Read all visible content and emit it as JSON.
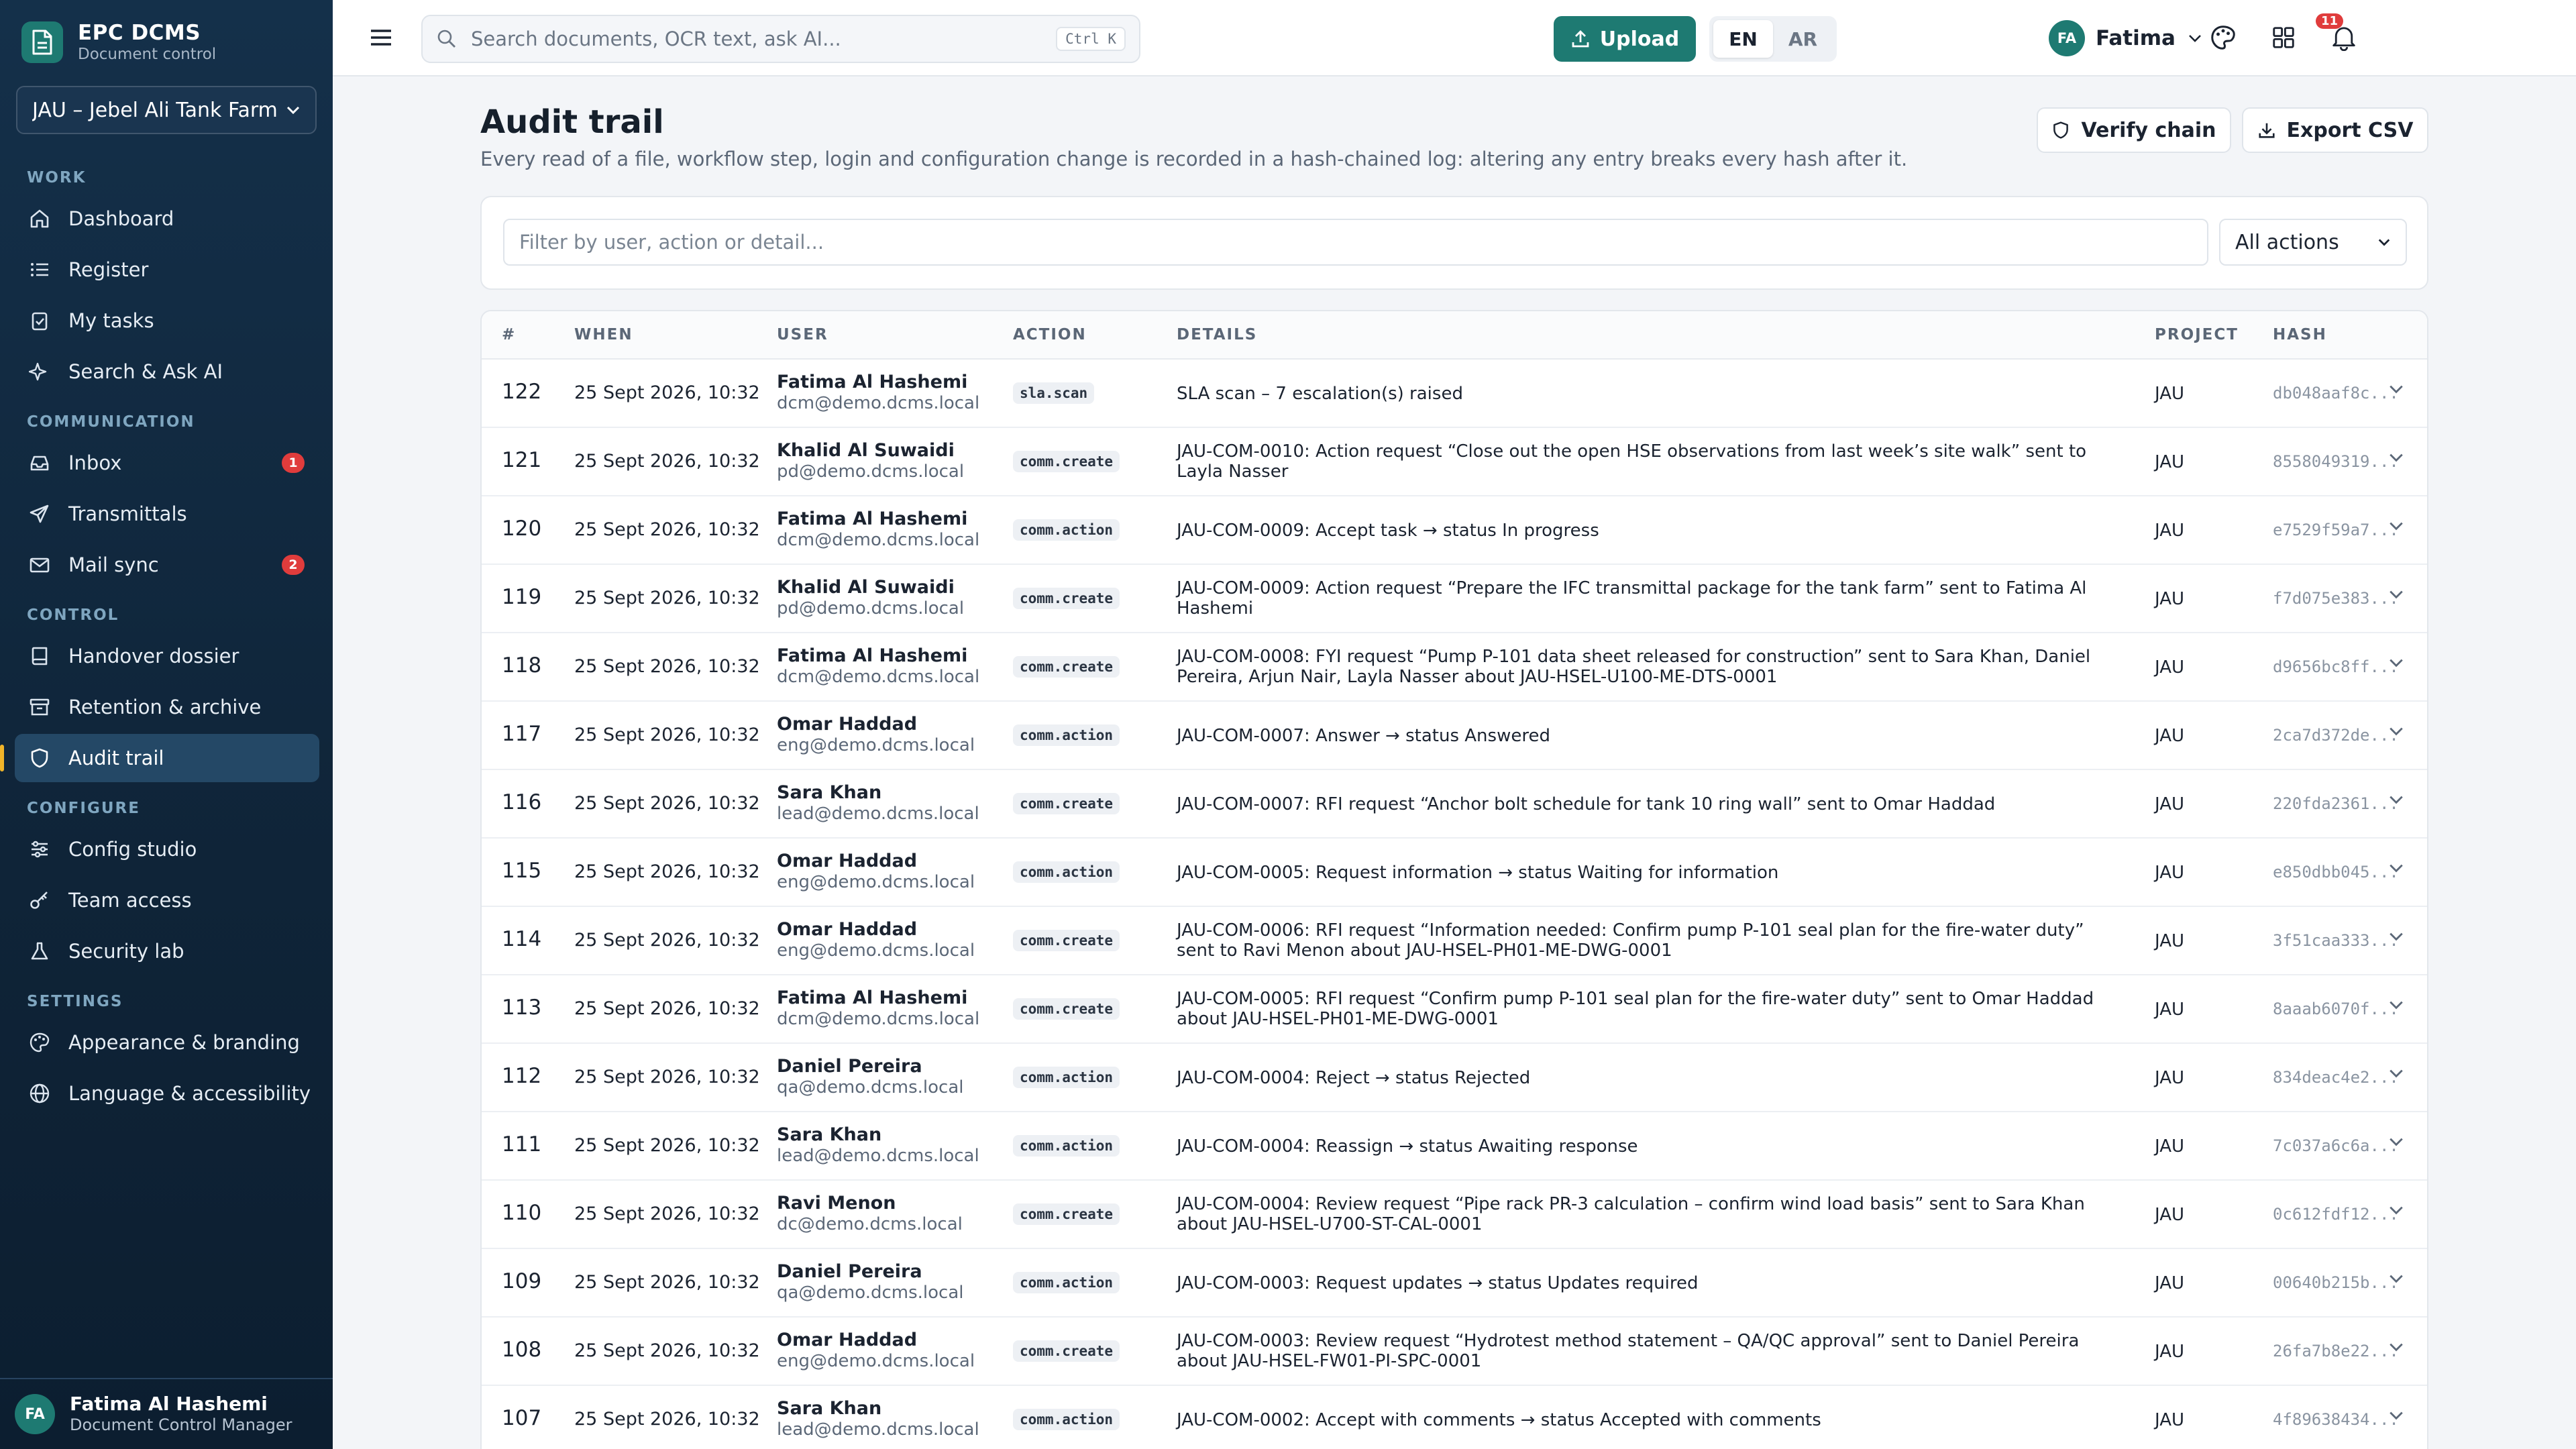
{
  "app": {
    "title": "EPC DCMS",
    "subtitle": "Document control"
  },
  "project_select": {
    "value": "JAU – Jebel Ali Tank Farm E"
  },
  "sidebar": {
    "sections": {
      "work": "WORK",
      "communication": "COMMUNICATION",
      "control": "CONTROL",
      "configure": "CONFIGURE",
      "settings": "SETTINGS"
    },
    "items": [
      {
        "label": "Dashboard",
        "icon": "home-icon"
      },
      {
        "label": "Register",
        "icon": "list-icon"
      },
      {
        "label": "My tasks",
        "icon": "clipboard-icon"
      },
      {
        "label": "Search & Ask AI",
        "icon": "sparkle-icon"
      },
      {
        "label": "Inbox",
        "icon": "inbox-icon",
        "badge": "1"
      },
      {
        "label": "Transmittals",
        "icon": "send-icon"
      },
      {
        "label": "Mail sync",
        "icon": "mail-icon",
        "badge": "2"
      },
      {
        "label": "Handover dossier",
        "icon": "book-icon"
      },
      {
        "label": "Retention & archive",
        "icon": "archive-icon"
      },
      {
        "label": "Audit trail",
        "icon": "shield-icon",
        "active": true
      },
      {
        "label": "Config studio",
        "icon": "sliders-icon"
      },
      {
        "label": "Team access",
        "icon": "key-icon"
      },
      {
        "label": "Security lab",
        "icon": "flask-icon"
      },
      {
        "label": "Appearance & branding",
        "icon": "palette-icon"
      },
      {
        "label": "Language & accessibility",
        "icon": "globe-icon"
      }
    ],
    "user": {
      "initials": "FA",
      "name": "Fatima Al Hashemi",
      "role": "Document Control Manager"
    }
  },
  "topbar": {
    "search_placeholder": "Search documents, OCR text, ask AI...",
    "search_shortcut": "Ctrl K",
    "upload_label": "Upload",
    "lang": {
      "en": "EN",
      "ar": "AR",
      "active": "EN"
    },
    "notifications_count": "11",
    "user": {
      "initials": "FA",
      "name": "Fatima"
    }
  },
  "page": {
    "title": "Audit trail",
    "description": "Every read of a file, workflow step, login and configuration change is recorded in a hash-chained log: altering any entry breaks every hash after it.",
    "verify_label": "Verify chain",
    "export_label": "Export CSV"
  },
  "filter": {
    "placeholder": "Filter by user, action or detail...",
    "action_select": "All actions"
  },
  "table": {
    "headers": {
      "num": "#",
      "when": "WHEN",
      "user": "USER",
      "action": "ACTION",
      "details": "DETAILS",
      "project": "PROJECT",
      "hash": "HASH"
    },
    "rows": [
      {
        "num": "122",
        "when": "25 Sept 2026, 10:32",
        "user": "Fatima Al Hashemi",
        "email": "dcm@demo.dcms.local",
        "action": "sla.scan",
        "details": "SLA scan – 7 escalation(s) raised",
        "project": "JAU",
        "hash": "db048aaf8c..."
      },
      {
        "num": "121",
        "when": "25 Sept 2026, 10:32",
        "user": "Khalid Al Suwaidi",
        "email": "pd@demo.dcms.local",
        "action": "comm.create",
        "details": "JAU-COM-0010: Action request “Close out the open HSE observations from last week’s site walk” sent to Layla Nasser",
        "project": "JAU",
        "hash": "8558049319..."
      },
      {
        "num": "120",
        "when": "25 Sept 2026, 10:32",
        "user": "Fatima Al Hashemi",
        "email": "dcm@demo.dcms.local",
        "action": "comm.action",
        "details": "JAU-COM-0009: Accept task → status In progress",
        "project": "JAU",
        "hash": "e7529f59a7..."
      },
      {
        "num": "119",
        "when": "25 Sept 2026, 10:32",
        "user": "Khalid Al Suwaidi",
        "email": "pd@demo.dcms.local",
        "action": "comm.create",
        "details": "JAU-COM-0009: Action request “Prepare the IFC transmittal package for the tank farm” sent to Fatima Al Hashemi",
        "project": "JAU",
        "hash": "f7d075e383..."
      },
      {
        "num": "118",
        "when": "25 Sept 2026, 10:32",
        "user": "Fatima Al Hashemi",
        "email": "dcm@demo.dcms.local",
        "action": "comm.create",
        "details": "JAU-COM-0008: FYI request “Pump P-101 data sheet released for construction” sent to Sara Khan, Daniel Pereira, Arjun Nair, Layla Nasser about JAU-HSEL-U100-ME-DTS-0001",
        "project": "JAU",
        "hash": "d9656bc8ff..."
      },
      {
        "num": "117",
        "when": "25 Sept 2026, 10:32",
        "user": "Omar Haddad",
        "email": "eng@demo.dcms.local",
        "action": "comm.action",
        "details": "JAU-COM-0007: Answer → status Answered",
        "project": "JAU",
        "hash": "2ca7d372de..."
      },
      {
        "num": "116",
        "when": "25 Sept 2026, 10:32",
        "user": "Sara Khan",
        "email": "lead@demo.dcms.local",
        "action": "comm.create",
        "details": "JAU-COM-0007: RFI request “Anchor bolt schedule for tank 10 ring wall” sent to Omar Haddad",
        "project": "JAU",
        "hash": "220fda2361..."
      },
      {
        "num": "115",
        "when": "25 Sept 2026, 10:32",
        "user": "Omar Haddad",
        "email": "eng@demo.dcms.local",
        "action": "comm.action",
        "details": "JAU-COM-0005: Request information → status Waiting for information",
        "project": "JAU",
        "hash": "e850dbb045..."
      },
      {
        "num": "114",
        "when": "25 Sept 2026, 10:32",
        "user": "Omar Haddad",
        "email": "eng@demo.dcms.local",
        "action": "comm.create",
        "details": "JAU-COM-0006: RFI request “Information needed: Confirm pump P-101 seal plan for the fire-water duty” sent to Ravi Menon about JAU-HSEL-PH01-ME-DWG-0001",
        "project": "JAU",
        "hash": "3f51caa333..."
      },
      {
        "num": "113",
        "when": "25 Sept 2026, 10:32",
        "user": "Fatima Al Hashemi",
        "email": "dcm@demo.dcms.local",
        "action": "comm.create",
        "details": "JAU-COM-0005: RFI request “Confirm pump P-101 seal plan for the fire-water duty” sent to Omar Haddad about JAU-HSEL-PH01-ME-DWG-0001",
        "project": "JAU",
        "hash": "8aaab6070f..."
      },
      {
        "num": "112",
        "when": "25 Sept 2026, 10:32",
        "user": "Daniel Pereira",
        "email": "qa@demo.dcms.local",
        "action": "comm.action",
        "details": "JAU-COM-0004: Reject → status Rejected",
        "project": "JAU",
        "hash": "834deac4e2..."
      },
      {
        "num": "111",
        "when": "25 Sept 2026, 10:32",
        "user": "Sara Khan",
        "email": "lead@demo.dcms.local",
        "action": "comm.action",
        "details": "JAU-COM-0004: Reassign → status Awaiting response",
        "project": "JAU",
        "hash": "7c037a6c6a..."
      },
      {
        "num": "110",
        "when": "25 Sept 2026, 10:32",
        "user": "Ravi Menon",
        "email": "dc@demo.dcms.local",
        "action": "comm.create",
        "details": "JAU-COM-0004: Review request “Pipe rack PR-3 calculation – confirm wind load basis” sent to Sara Khan about JAU-HSEL-U700-ST-CAL-0001",
        "project": "JAU",
        "hash": "0c612fdf12..."
      },
      {
        "num": "109",
        "when": "25 Sept 2026, 10:32",
        "user": "Daniel Pereira",
        "email": "qa@demo.dcms.local",
        "action": "comm.action",
        "details": "JAU-COM-0003: Request updates → status Updates required",
        "project": "JAU",
        "hash": "00640b215b..."
      },
      {
        "num": "108",
        "when": "25 Sept 2026, 10:32",
        "user": "Omar Haddad",
        "email": "eng@demo.dcms.local",
        "action": "comm.create",
        "details": "JAU-COM-0003: Review request “Hydrotest method statement – QA/QC approval” sent to Daniel Pereira about JAU-HSEL-FW01-PI-SPC-0001",
        "project": "JAU",
        "hash": "26fa7b8e22..."
      },
      {
        "num": "107",
        "when": "25 Sept 2026, 10:32",
        "user": "Sara Khan",
        "email": "lead@demo.dcms.local",
        "action": "comm.action",
        "details": "JAU-COM-0002: Accept with comments → status Accepted with comments",
        "project": "JAU",
        "hash": "4f89638434..."
      }
    ]
  },
  "colors": {
    "sidebar_bg": "#14304a",
    "accent": "#1e7a72",
    "active_marker": "#f0b429",
    "badge": "#e03c3c"
  }
}
